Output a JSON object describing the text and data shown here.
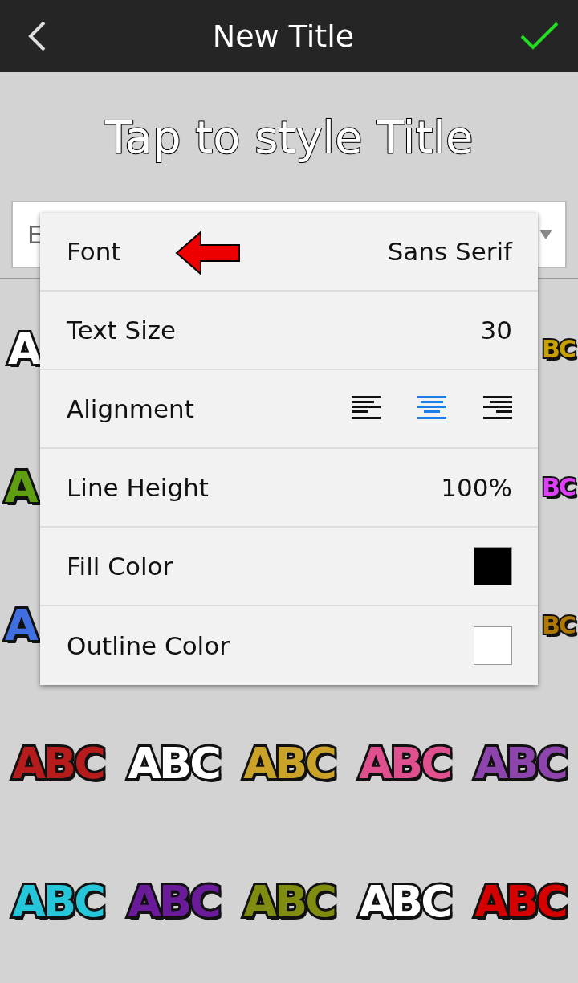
{
  "app_bar": {
    "title": "New Title"
  },
  "preview": {
    "text": "Tap to style Title"
  },
  "text_field": {
    "placeholder": "E"
  },
  "style_rows": [
    {
      "tiles": [
        {
          "text": "A",
          "color": "#ffffff"
        },
        {
          "text": "BC",
          "color": "#c8a000"
        }
      ]
    },
    {
      "tiles": [
        {
          "text": "A",
          "color": "#5f9e10"
        },
        {
          "text": "BC",
          "color": "#e040fb"
        }
      ]
    },
    {
      "tiles": [
        {
          "text": "A",
          "color": "#3f6fe0"
        },
        {
          "text": "BC",
          "color": "#b07800"
        }
      ]
    },
    {
      "tiles": [
        {
          "text": "ABC",
          "color": "#b71c1c"
        },
        {
          "text": "ABC",
          "color": "#ffffff"
        },
        {
          "text": "ABC",
          "color": "#c9a227"
        },
        {
          "text": "ABC",
          "color": "#e0508e"
        },
        {
          "text": "ABC",
          "color": "#8e44ad"
        }
      ]
    },
    {
      "tiles": [
        {
          "text": "ABC",
          "color": "#26c6da"
        },
        {
          "text": "ABC",
          "color": "#6a1b9a"
        },
        {
          "text": "ABC",
          "color": "#7f8c10"
        },
        {
          "text": "ABC",
          "color": "#ffffff"
        },
        {
          "text": "ABC",
          "color": "#d50000"
        }
      ]
    }
  ],
  "style_menu": [
    {
      "kind": "value",
      "label": "Font",
      "value": "Sans Serif"
    },
    {
      "kind": "value",
      "label": "Text Size",
      "value": "30"
    },
    {
      "kind": "alignment",
      "label": "Alignment",
      "options": [
        {
          "kind": "left",
          "selected": false
        },
        {
          "kind": "center",
          "selected": true
        },
        {
          "kind": "right",
          "selected": false
        }
      ]
    },
    {
      "kind": "value",
      "label": "Line Height",
      "value": "100%"
    },
    {
      "kind": "swatch",
      "label": "Fill Color",
      "color": "#000000"
    },
    {
      "kind": "swatch",
      "label": "Outline Color",
      "color": "#ffffff"
    }
  ]
}
